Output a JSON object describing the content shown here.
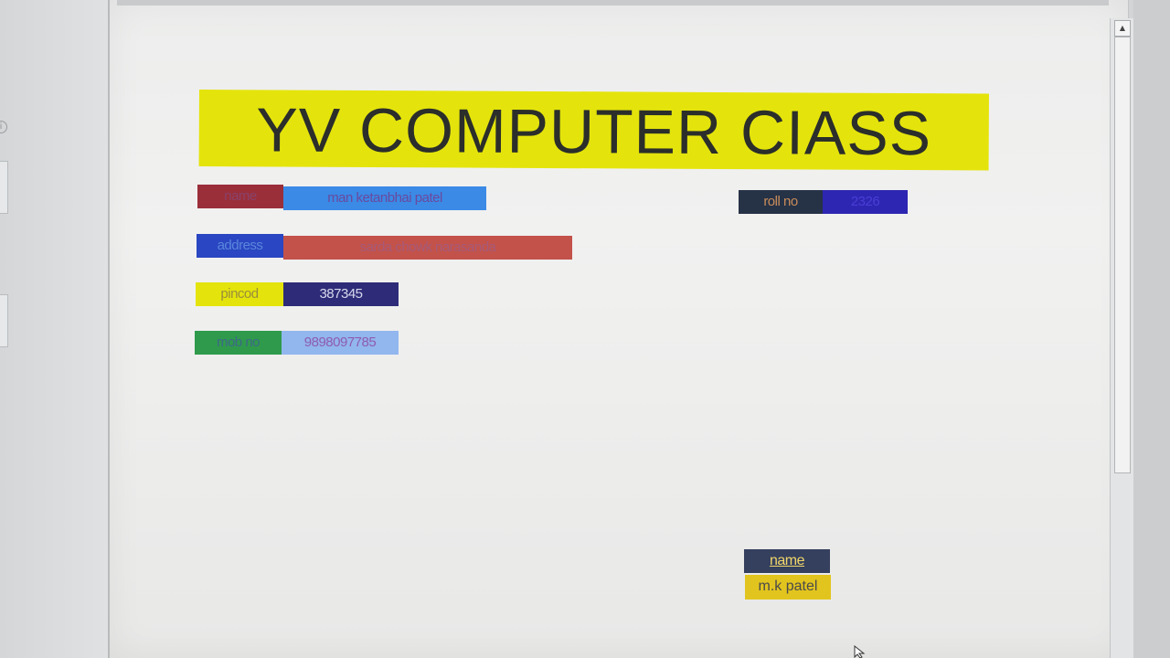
{
  "title": "YV COMPUTER CIASS",
  "fields": {
    "name": {
      "label": "name",
      "value": "man ketanbhai patel"
    },
    "address": {
      "label": "address",
      "value": "sarda chowk narasanda"
    },
    "pincode": {
      "label": "pincod",
      "value": "387345"
    },
    "mobile": {
      "label": "mob no",
      "value": "9898097785"
    },
    "roll_no": {
      "label": "roll no",
      "value": "2326"
    }
  },
  "signature": {
    "label": "name",
    "value": "m.k patel"
  },
  "colors": {
    "title_bg": "#e4e40c",
    "name_label_bg": "#9a2f3a",
    "name_value_bg": "#3a8ae6",
    "address_label_bg": "#2a46c2",
    "address_value_bg": "#c2524a",
    "pincode_label_bg": "#e4e40c",
    "pincode_value_bg": "#2e2c78",
    "mobile_label_bg": "#2f9a4c",
    "mobile_value_bg": "#92b6ee",
    "roll_label_bg": "#263246",
    "roll_value_bg": "#2d26b2",
    "sig_label_bg": "#35405e",
    "sig_value_bg": "#e2c41e"
  },
  "icons": {
    "scroll_up": "triangle-up-icon",
    "cursor": "mouse-pointer-icon",
    "info": "info-circle-icon"
  }
}
